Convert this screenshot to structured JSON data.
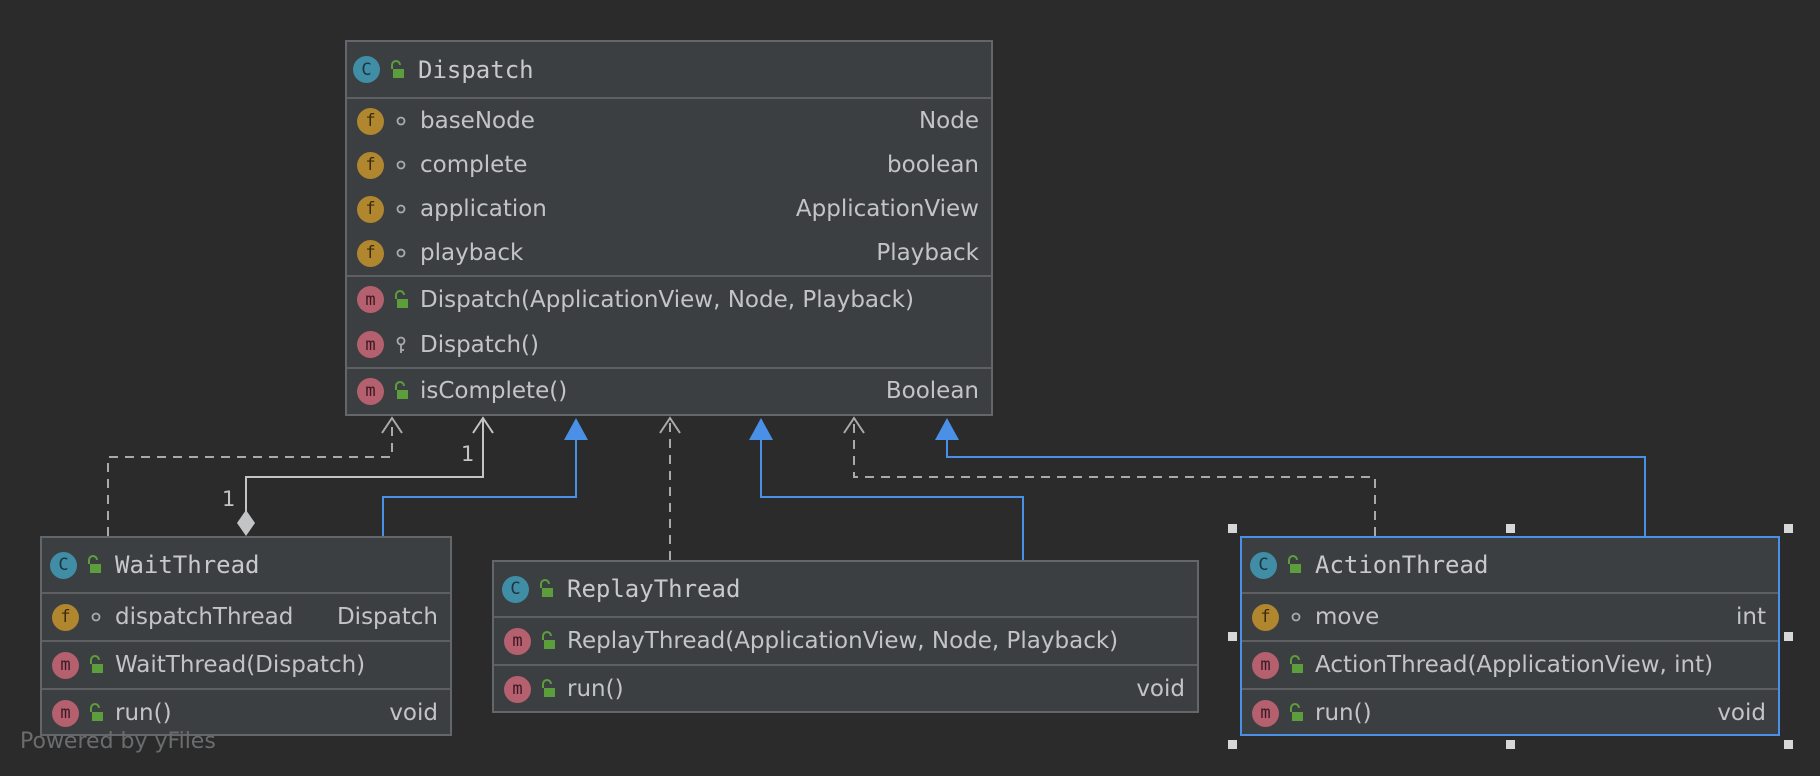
{
  "colors": {
    "background": "#2b2b2c",
    "node_background": "#3c3f41",
    "node_border": "#646669",
    "selected_border": "#4a90e6",
    "inheritance_edge": "#4a90e6",
    "dependency_edge": "#a9aaab",
    "class_badge": "#3f8ea6",
    "field_badge": "#b0862f",
    "method_badge": "#b5606f",
    "public_lock": "#5c9e3c"
  },
  "classes": {
    "dispatch": {
      "name": "Dispatch",
      "fields": [
        {
          "name": "baseNode",
          "type": "Node",
          "visibility": "package"
        },
        {
          "name": "complete",
          "type": "boolean",
          "visibility": "package"
        },
        {
          "name": "application",
          "type": "ApplicationView",
          "visibility": "package"
        },
        {
          "name": "playback",
          "type": "Playback",
          "visibility": "package"
        }
      ],
      "constructors": [
        {
          "name": "Dispatch(ApplicationView, Node, Playback)",
          "visibility": "public"
        },
        {
          "name": "Dispatch()",
          "visibility": "private"
        }
      ],
      "methods": [
        {
          "name": "isComplete()",
          "type": "Boolean",
          "visibility": "public"
        }
      ]
    },
    "wait_thread": {
      "name": "WaitThread",
      "fields": [
        {
          "name": "dispatchThread",
          "type": "Dispatch",
          "visibility": "package"
        }
      ],
      "constructors": [
        {
          "name": "WaitThread(Dispatch)",
          "visibility": "public"
        }
      ],
      "methods": [
        {
          "name": "run()",
          "type": "void",
          "visibility": "public"
        }
      ]
    },
    "replay_thread": {
      "name": "ReplayThread",
      "constructors": [
        {
          "name": "ReplayThread(ApplicationView, Node, Playback)",
          "visibility": "public"
        }
      ],
      "methods": [
        {
          "name": "run()",
          "type": "void",
          "visibility": "public"
        }
      ]
    },
    "action_thread": {
      "name": "ActionThread",
      "fields": [
        {
          "name": "move",
          "type": "int",
          "visibility": "package"
        }
      ],
      "constructors": [
        {
          "name": "ActionThread(ApplicationView, int)",
          "visibility": "public"
        }
      ],
      "methods": [
        {
          "name": "run()",
          "type": "void",
          "visibility": "public"
        }
      ]
    }
  },
  "badges": {
    "class": "C",
    "field": "f",
    "method": "m"
  },
  "relations": {
    "composition_source_multiplicity": "1",
    "composition_target_multiplicity": "1"
  },
  "footer": "Powered by yFiles"
}
